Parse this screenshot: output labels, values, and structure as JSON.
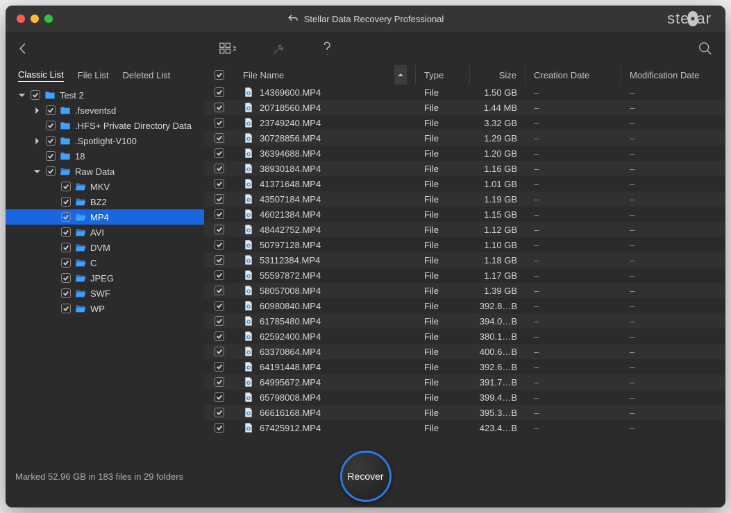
{
  "app_title": "Stellar Data Recovery Professional",
  "brand": "stellar",
  "tabs": {
    "classic": "Classic List",
    "filelist": "File List",
    "deleted": "Deleted List"
  },
  "columns": {
    "filename": "File Name",
    "type": "Type",
    "size": "Size",
    "creation": "Creation Date",
    "modification": "Modification Date"
  },
  "tree": [
    {
      "label": "Test 2",
      "indent": 0,
      "tw": "down",
      "open": false,
      "sel": false
    },
    {
      "label": ".fseventsd",
      "indent": 1,
      "tw": "right",
      "open": false,
      "sel": false
    },
    {
      "label": ".HFS+ Private Directory Data",
      "indent": 1,
      "tw": "",
      "open": false,
      "sel": false
    },
    {
      "label": ".Spotlight-V100",
      "indent": 1,
      "tw": "right",
      "open": false,
      "sel": false
    },
    {
      "label": "18",
      "indent": 1,
      "tw": "",
      "open": false,
      "sel": false
    },
    {
      "label": "Raw Data",
      "indent": 1,
      "tw": "down",
      "open": true,
      "sel": false
    },
    {
      "label": "MKV",
      "indent": 2,
      "tw": "",
      "open": true,
      "sel": false
    },
    {
      "label": "BZ2",
      "indent": 2,
      "tw": "",
      "open": true,
      "sel": false
    },
    {
      "label": "MP4",
      "indent": 2,
      "tw": "",
      "open": true,
      "sel": true
    },
    {
      "label": "AVI",
      "indent": 2,
      "tw": "",
      "open": true,
      "sel": false
    },
    {
      "label": "DVM",
      "indent": 2,
      "tw": "",
      "open": true,
      "sel": false
    },
    {
      "label": "C",
      "indent": 2,
      "tw": "",
      "open": true,
      "sel": false
    },
    {
      "label": "JPEG",
      "indent": 2,
      "tw": "",
      "open": true,
      "sel": false
    },
    {
      "label": "SWF",
      "indent": 2,
      "tw": "",
      "open": true,
      "sel": false
    },
    {
      "label": "WP",
      "indent": 2,
      "tw": "",
      "open": true,
      "sel": false
    }
  ],
  "rows": [
    {
      "name": "14369600.MP4",
      "type": "File",
      "size": "1.50 GB"
    },
    {
      "name": "20718560.MP4",
      "type": "File",
      "size": "1.44 MB"
    },
    {
      "name": "23749240.MP4",
      "type": "File",
      "size": "3.32 GB"
    },
    {
      "name": "30728856.MP4",
      "type": "File",
      "size": "1.29 GB"
    },
    {
      "name": "36394688.MP4",
      "type": "File",
      "size": "1.20 GB"
    },
    {
      "name": "38930184.MP4",
      "type": "File",
      "size": "1.16 GB"
    },
    {
      "name": "41371648.MP4",
      "type": "File",
      "size": "1.01 GB"
    },
    {
      "name": "43507184.MP4",
      "type": "File",
      "size": "1.19 GB"
    },
    {
      "name": "46021384.MP4",
      "type": "File",
      "size": "1.15 GB"
    },
    {
      "name": "48442752.MP4",
      "type": "File",
      "size": "1.12 GB"
    },
    {
      "name": "50797128.MP4",
      "type": "File",
      "size": "1.10 GB"
    },
    {
      "name": "53112384.MP4",
      "type": "File",
      "size": "1.18 GB"
    },
    {
      "name": "55597872.MP4",
      "type": "File",
      "size": "1.17 GB"
    },
    {
      "name": "58057008.MP4",
      "type": "File",
      "size": "1.39 GB"
    },
    {
      "name": "60980840.MP4",
      "type": "File",
      "size": "392.8…B"
    },
    {
      "name": "61785480.MP4",
      "type": "File",
      "size": "394.0…B"
    },
    {
      "name": "62592400.MP4",
      "type": "File",
      "size": "380.1…B"
    },
    {
      "name": "63370864.MP4",
      "type": "File",
      "size": "400.6…B"
    },
    {
      "name": "64191448.MP4",
      "type": "File",
      "size": "392.6…B"
    },
    {
      "name": "64995672.MP4",
      "type": "File",
      "size": "391.7…B"
    },
    {
      "name": "65798008.MP4",
      "type": "File",
      "size": "399.4…B"
    },
    {
      "name": "66616168.MP4",
      "type": "File",
      "size": "395.3…B"
    },
    {
      "name": "67425912.MP4",
      "type": "File",
      "size": "423.4…B"
    }
  ],
  "dash": "–",
  "status": "Marked 52.96 GB in 183 files in 29 folders",
  "recover": "Recover"
}
